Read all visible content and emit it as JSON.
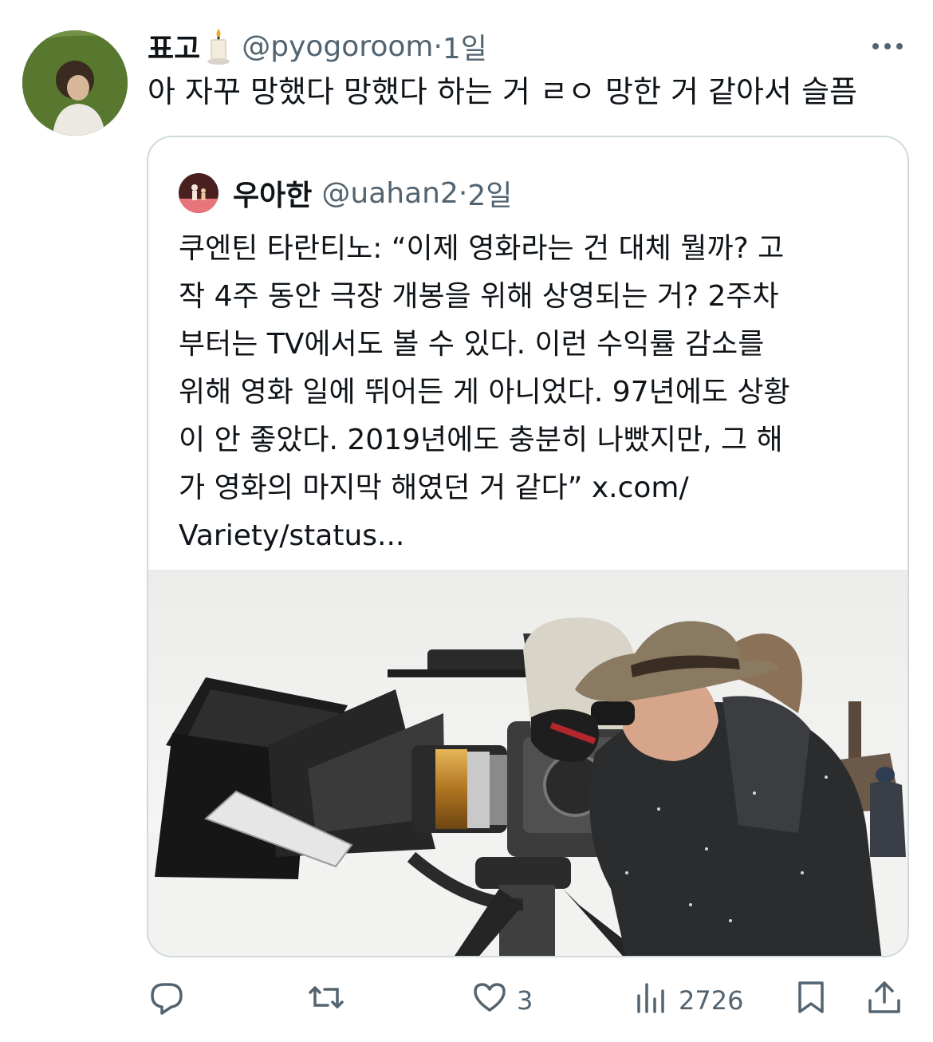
{
  "tweet": {
    "author_name": "표고",
    "author_handle": "@pyogoroom",
    "time": "1일",
    "text": "아 자꾸 망했다 망했다 하는 거 ㄹㅇ 망한 거 같아서 슬픔"
  },
  "quote": {
    "author_name": "우아한",
    "author_handle": "@uahan2",
    "time": "2일",
    "lines": [
      "쿠엔틴 타란티노: “이제 영화라는 건 대체 뭘까? 고",
      "작 4주 동안 극장 개봉을 위해 상영되는 거? 2주차",
      "부터는 TV에서도 볼 수 있다. 이런 수익률 감소를",
      "위해 영화 일에 뛰어든 게 아니었다. 97년에도 상황",
      "이 안 좋았다. 2019년에도 충분히 나빴지만, 그 해",
      "가 영화의 마지막 해였던 거 같다” x.com/",
      "Variety/status..."
    ]
  },
  "actions": {
    "reply_count": "",
    "retweet_count": "",
    "like_count": "3",
    "view_count": "2726"
  },
  "icons": {
    "more": "more-icon",
    "reply": "reply-icon",
    "retweet": "retweet-icon",
    "like": "heart-icon",
    "views": "views-icon",
    "bookmark": "bookmark-icon",
    "share": "share-icon"
  },
  "colors": {
    "text": "#0f1419",
    "secondary": "#536471",
    "border": "#cfd9de"
  }
}
